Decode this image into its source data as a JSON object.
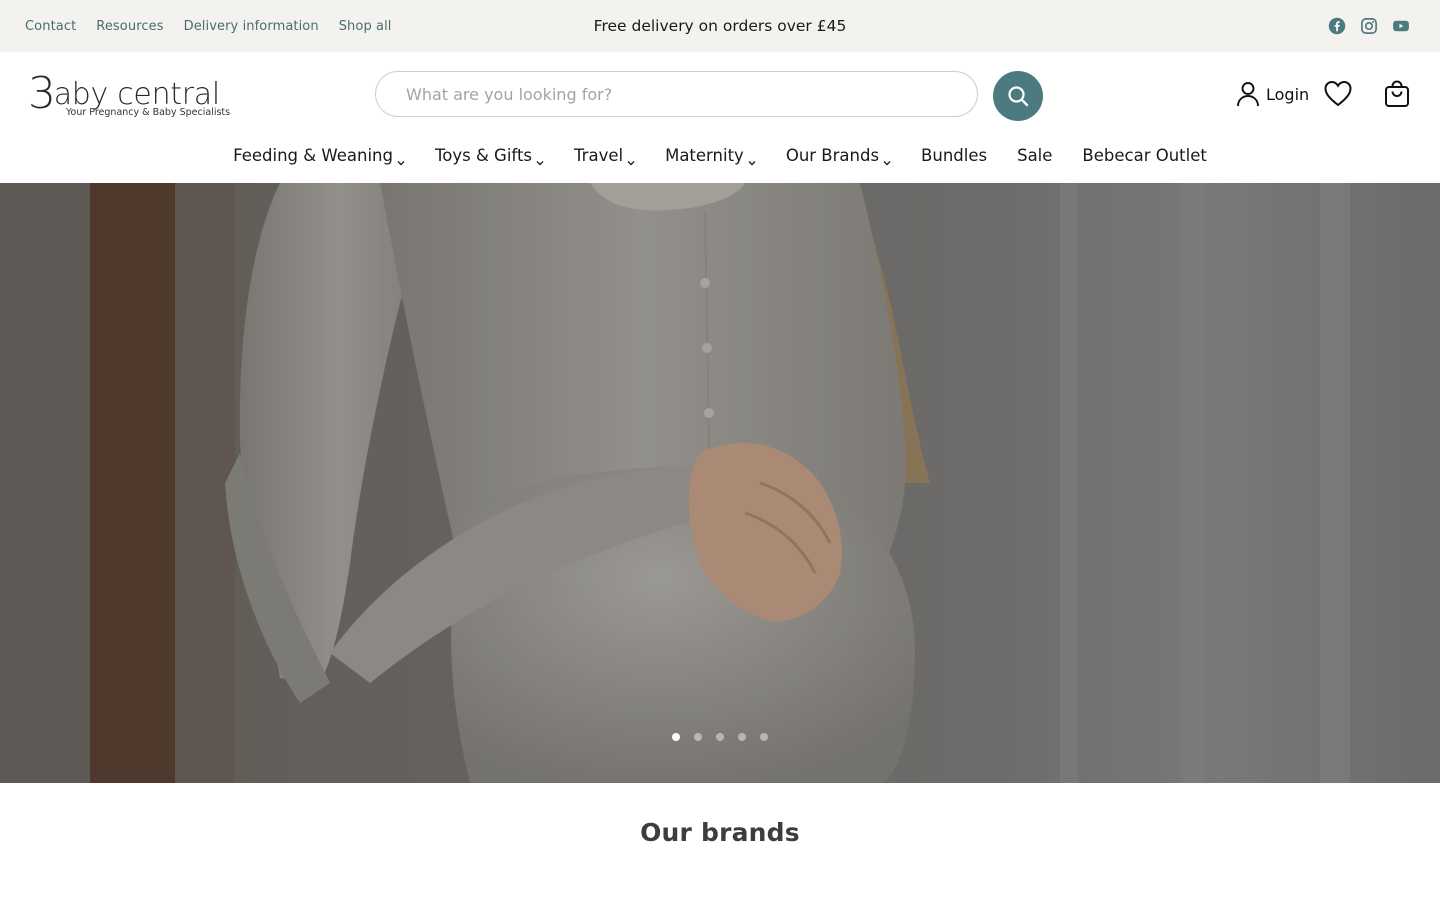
{
  "topbar": {
    "links": [
      "Contact",
      "Resources",
      "Delivery information",
      "Shop all"
    ],
    "promo": "Free delivery on orders over £45",
    "social": [
      "facebook-icon",
      "instagram-icon",
      "youtube-icon"
    ],
    "bg_color": "#f3f2ef",
    "link_color": "#4c6b70"
  },
  "header": {
    "logo_text": "aby central",
    "logo_initial": "3",
    "logo_tagline": "Your Pregnancy & Baby Specialists",
    "search_placeholder": "What are you looking for?",
    "search_value": "",
    "search_button_color": "#4c7a80",
    "login_label": "Login",
    "icons": [
      "user-icon",
      "heart-icon",
      "shopping-bag-icon",
      "search-icon"
    ]
  },
  "nav": {
    "items": [
      {
        "label": "Feeding & Weaning",
        "dropdown": true
      },
      {
        "label": "Toys & Gifts",
        "dropdown": true
      },
      {
        "label": "Travel",
        "dropdown": true
      },
      {
        "label": "Maternity",
        "dropdown": true
      },
      {
        "label": "Our Brands",
        "dropdown": true
      },
      {
        "label": "Bundles",
        "dropdown": false
      },
      {
        "label": "Sale",
        "dropdown": false
      },
      {
        "label": "Bebecar Outlet",
        "dropdown": false
      }
    ]
  },
  "hero": {
    "slide_count": 5,
    "active_slide": 1
  },
  "brands": {
    "title": "Our brands"
  }
}
